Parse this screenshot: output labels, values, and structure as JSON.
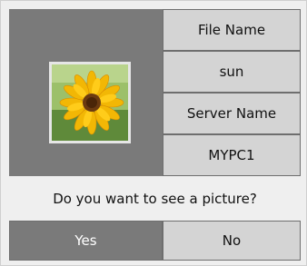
{
  "file": {
    "name_label": "File Name",
    "name_value": "sun",
    "server_label": "Server Name",
    "server_value": "MYPC1",
    "thumbnail_icon": "sunflower-thumbnail"
  },
  "prompt": {
    "question": "Do you want to see a picture?",
    "yes_label": "Yes",
    "no_label": "No"
  },
  "colors": {
    "panel_dark": "#7a7a7a",
    "row_light": "#d4d4d4",
    "background": "#efefef"
  }
}
